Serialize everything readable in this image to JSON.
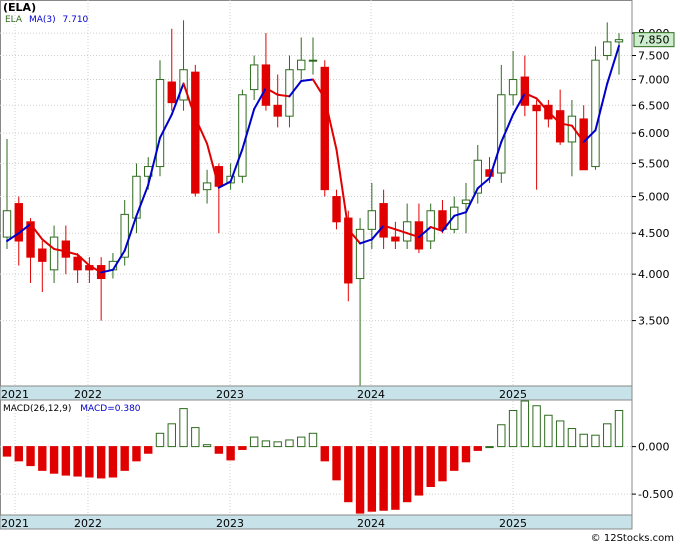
{
  "title": "(ELA)",
  "legend": {
    "symbol": "ELA",
    "ma_label": "MA(3)",
    "ma_value": "7.710"
  },
  "macd_legend": {
    "label": "MACD(26,12,9)",
    "value_label": "MACD=0.380"
  },
  "last_price_tag": "7.850",
  "watermark": "© 12Stocks.com",
  "colors": {
    "up": "#2e6b1e",
    "down": "#e00000",
    "ma_up": "#0000cc",
    "ma_down": "#e00000",
    "axis_band": "#c8e2ea"
  },
  "chart_data": [
    {
      "type": "candlestick",
      "scale": "log",
      "ylim": [
        2.9,
        8.5
      ],
      "yticks": [
        "3.500",
        "4.000",
        "4.500",
        "5.000",
        "5.500",
        "6.000",
        "6.500",
        "7.000",
        "7.500",
        "8.000"
      ],
      "x_labels": [
        "2021",
        "2022",
        "2023",
        "2024",
        "2025"
      ],
      "candles": [
        [
          4.45,
          4.8,
          4.3,
          5.9
        ],
        [
          4.9,
          4.4,
          4.1,
          5.0
        ],
        [
          4.65,
          4.2,
          3.9,
          4.7
        ],
        [
          4.3,
          4.15,
          3.8,
          4.4
        ],
        [
          4.05,
          4.45,
          3.9,
          4.6
        ],
        [
          4.4,
          4.2,
          4.0,
          4.6
        ],
        [
          4.2,
          4.05,
          3.9,
          4.25
        ],
        [
          4.1,
          4.05,
          3.9,
          4.2
        ],
        [
          4.1,
          3.95,
          3.5,
          4.2
        ],
        [
          4.05,
          4.15,
          3.95,
          4.25
        ],
        [
          4.2,
          4.75,
          4.1,
          4.95
        ],
        [
          4.7,
          5.3,
          4.5,
          5.5
        ],
        [
          5.3,
          5.45,
          5.1,
          5.6
        ],
        [
          5.45,
          7.0,
          5.3,
          7.4
        ],
        [
          6.95,
          6.55,
          6.4,
          8.1
        ],
        [
          6.6,
          7.2,
          6.4,
          8.3
        ],
        [
          7.15,
          5.05,
          5.0,
          7.3
        ],
        [
          5.1,
          5.2,
          4.9,
          5.4
        ],
        [
          5.45,
          5.15,
          4.5,
          5.5
        ],
        [
          5.2,
          5.3,
          5.1,
          5.5
        ],
        [
          5.3,
          6.7,
          5.2,
          6.8
        ],
        [
          6.8,
          7.3,
          6.6,
          7.5
        ],
        [
          7.3,
          6.5,
          6.4,
          8.0
        ],
        [
          6.5,
          6.3,
          6.1,
          7.1
        ],
        [
          6.3,
          7.2,
          6.1,
          7.5
        ],
        [
          7.2,
          7.4,
          7.0,
          7.9
        ],
        [
          7.4,
          7.4,
          7.1,
          7.9
        ],
        [
          7.25,
          5.1,
          5.0,
          7.4
        ],
        [
          5.0,
          4.65,
          4.55,
          5.1
        ],
        [
          4.7,
          3.9,
          3.7,
          4.8
        ],
        [
          3.95,
          4.55,
          2.8,
          4.7
        ],
        [
          4.55,
          4.8,
          4.3,
          5.2
        ],
        [
          4.9,
          4.45,
          4.3,
          5.1
        ],
        [
          4.45,
          4.4,
          4.3,
          4.65
        ],
        [
          4.4,
          4.65,
          4.3,
          4.9
        ],
        [
          4.65,
          4.3,
          4.25,
          4.9
        ],
        [
          4.4,
          4.8,
          4.3,
          4.9
        ],
        [
          4.8,
          4.55,
          4.5,
          4.95
        ],
        [
          4.55,
          4.85,
          4.5,
          5.0
        ],
        [
          4.9,
          4.95,
          4.5,
          5.2
        ],
        [
          5.05,
          5.55,
          4.9,
          5.8
        ],
        [
          5.4,
          5.3,
          5.2,
          5.6
        ],
        [
          5.35,
          6.7,
          5.2,
          7.3
        ],
        [
          6.7,
          7.0,
          6.5,
          7.6
        ],
        [
          7.05,
          6.5,
          6.3,
          7.5
        ],
        [
          6.5,
          6.4,
          5.1,
          6.6
        ],
        [
          6.5,
          6.25,
          6.1,
          6.6
        ],
        [
          6.4,
          5.85,
          5.8,
          6.8
        ],
        [
          5.85,
          6.3,
          5.3,
          6.6
        ],
        [
          6.25,
          5.4,
          5.4,
          6.5
        ],
        [
          5.45,
          7.4,
          5.4,
          7.7
        ],
        [
          7.5,
          7.8,
          7.4,
          8.25
        ],
        [
          7.8,
          7.85,
          7.1,
          8.0
        ]
      ],
      "ma": [
        4.4,
        4.5,
        4.62,
        4.42,
        4.3,
        4.27,
        4.23,
        4.1,
        4.02,
        4.05,
        4.28,
        4.73,
        5.17,
        5.92,
        6.33,
        6.92,
        6.27,
        5.82,
        5.13,
        5.22,
        5.73,
        6.43,
        6.83,
        6.7,
        6.67,
        6.97,
        7.0,
        6.63,
        5.72,
        4.55,
        4.37,
        4.42,
        4.6,
        4.55,
        4.5,
        4.45,
        4.58,
        4.53,
        4.73,
        4.78,
        5.12,
        5.27,
        5.85,
        6.33,
        6.73,
        6.63,
        6.38,
        6.17,
        6.13,
        5.85,
        6.05,
        6.92,
        7.71
      ]
    },
    {
      "type": "bar",
      "title": "MACD(26,12,9)",
      "ylim": [
        -0.72,
        0.48
      ],
      "yticks": [
        "0.000",
        "-0.500"
      ],
      "x_labels": [
        "2021",
        "2022",
        "2023",
        "2024",
        "2025"
      ],
      "values": [
        -0.1,
        -0.15,
        -0.2,
        -0.25,
        -0.28,
        -0.3,
        -0.31,
        -0.32,
        -0.33,
        -0.32,
        -0.25,
        -0.15,
        -0.07,
        0.14,
        0.24,
        0.4,
        0.2,
        0.02,
        -0.07,
        -0.14,
        -0.03,
        0.1,
        0.06,
        0.05,
        0.07,
        0.1,
        0.14,
        -0.15,
        -0.35,
        -0.58,
        -0.7,
        -0.68,
        -0.67,
        -0.66,
        -0.58,
        -0.51,
        -0.42,
        -0.36,
        -0.25,
        -0.16,
        -0.04,
        0.0,
        0.23,
        0.38,
        0.48,
        0.43,
        0.33,
        0.27,
        0.19,
        0.13,
        0.12,
        0.24,
        0.38
      ]
    }
  ]
}
